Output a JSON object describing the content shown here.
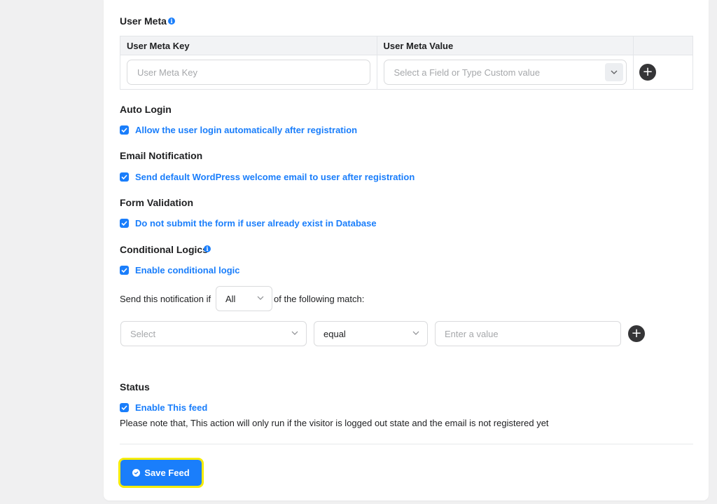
{
  "user_meta": {
    "title": "User Meta",
    "col_key": "User Meta Key",
    "col_value": "User Meta Value",
    "key_placeholder": "User Meta Key",
    "value_placeholder": "Select a Field or Type Custom value"
  },
  "auto_login": {
    "title": "Auto Login",
    "checkbox_label": "Allow the user login automatically after registration"
  },
  "email_notification": {
    "title": "Email Notification",
    "checkbox_label": "Send default WordPress welcome email to user after registration"
  },
  "form_validation": {
    "title": "Form Validation",
    "checkbox_label": "Do not submit the form if user already exist in Database"
  },
  "conditional_logics": {
    "title": "Conditional Logics",
    "checkbox_label": "Enable conditional logic",
    "sentence_prefix": "Send this notification if",
    "match_value": "All",
    "sentence_suffix": "of the following match:",
    "field_placeholder": "Select",
    "operator_value": "equal",
    "value_placeholder": "Enter a value"
  },
  "status": {
    "title": "Status",
    "checkbox_label": "Enable This feed",
    "note": "Please note that, This action will only run if the visitor is logged out state and the email is not registered yet"
  },
  "save_button": {
    "label": "Save Feed"
  },
  "colors": {
    "accent": "#1a7efb",
    "highlight": "#f5ec00",
    "background": "#f0f0f1"
  }
}
